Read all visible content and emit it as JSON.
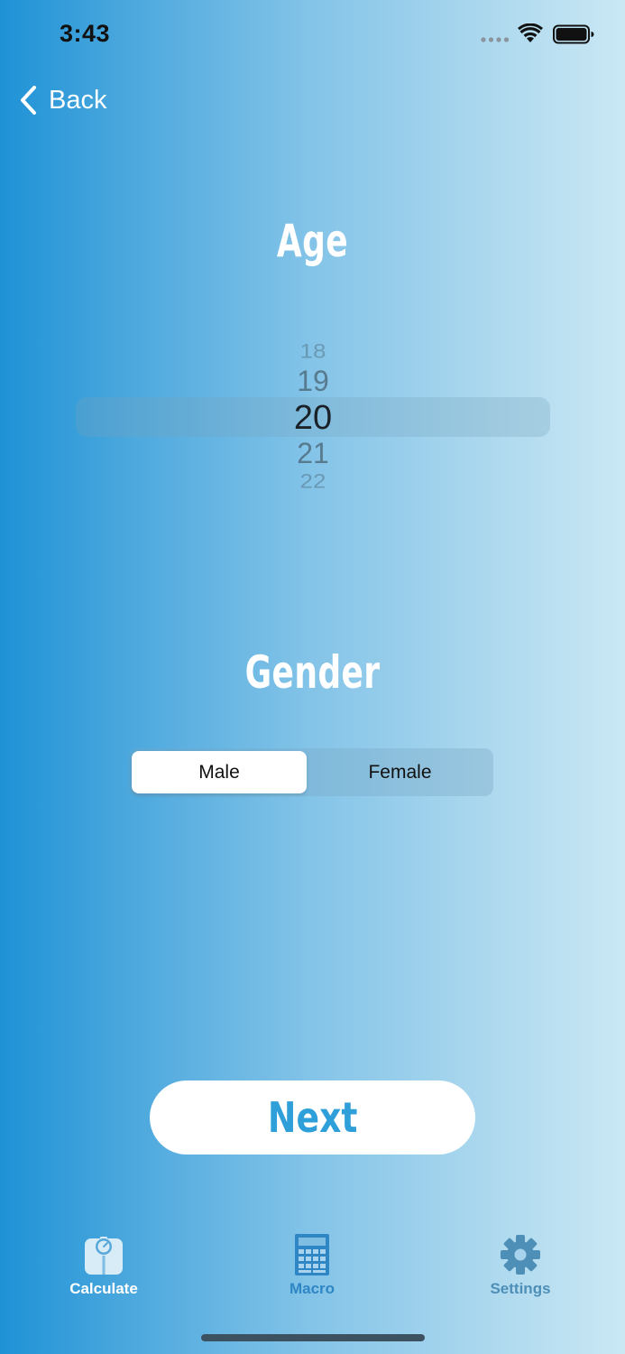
{
  "status_bar": {
    "time": "3:43"
  },
  "nav": {
    "back_label": "Back"
  },
  "age": {
    "title": "Age",
    "options": [
      "18",
      "19",
      "20",
      "21",
      "22"
    ],
    "selected": "20"
  },
  "gender": {
    "title": "Gender",
    "options": [
      "Male",
      "Female"
    ],
    "selected": "Male"
  },
  "next_button": {
    "label": "Next"
  },
  "tab_bar": {
    "items": [
      {
        "label": "Calculate",
        "icon": "scale-icon"
      },
      {
        "label": "Macro",
        "icon": "calculator-icon"
      },
      {
        "label": "Settings",
        "icon": "gear-icon"
      }
    ],
    "active": "Macro"
  },
  "colors": {
    "gradient_left": "#1e92d6",
    "gradient_right": "#cae8f4",
    "accent": "#2f9fd9",
    "tab_active": "#2f86c4",
    "tab_inactive": "#4e8fb8"
  }
}
